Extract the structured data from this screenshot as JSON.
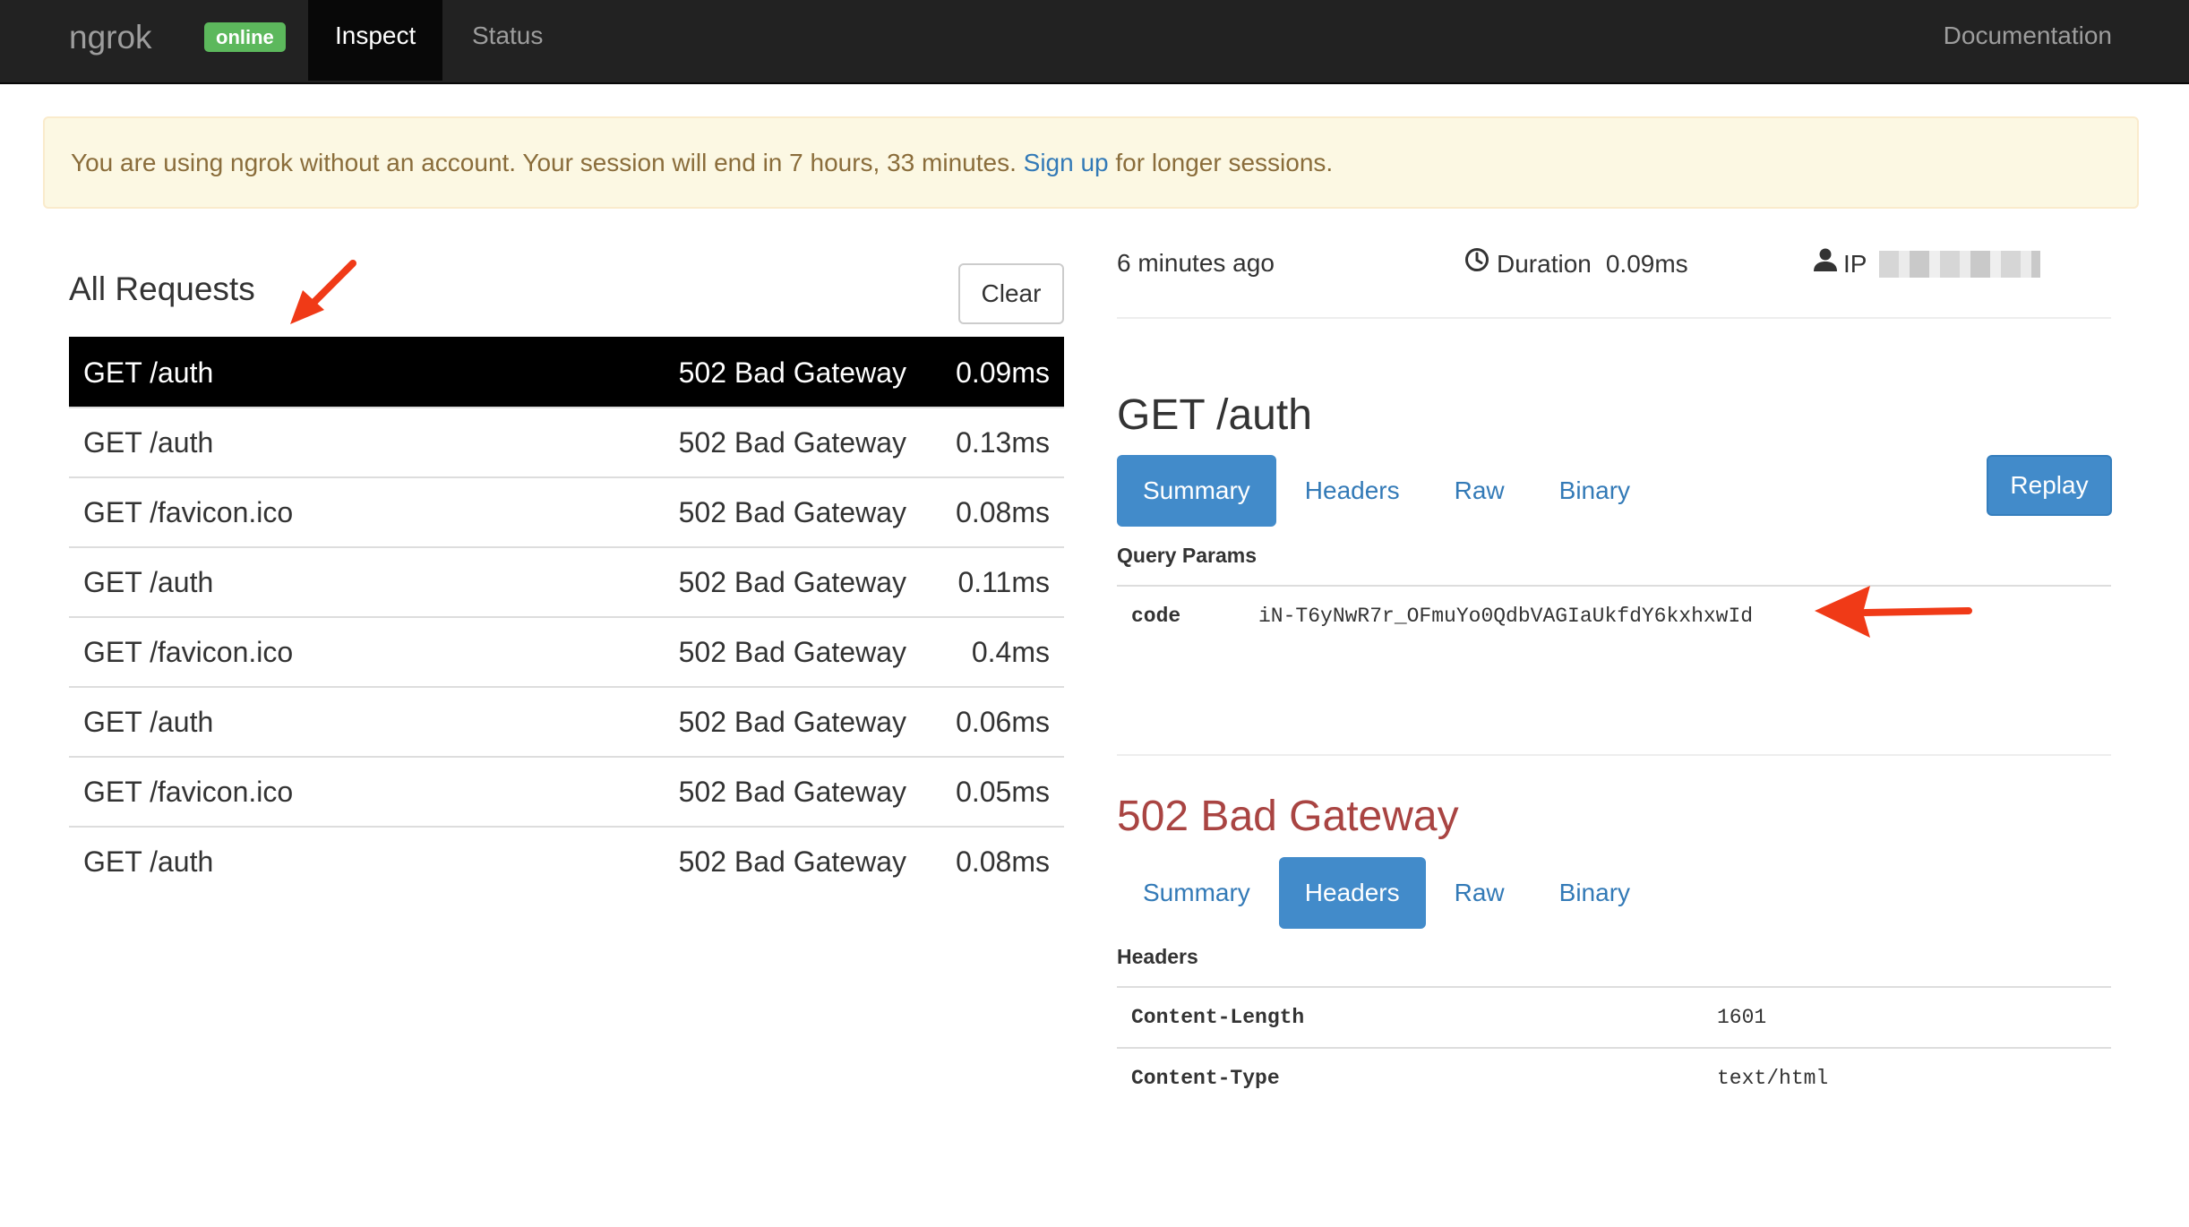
{
  "navbar": {
    "brand": "ngrok",
    "status_badge": "online",
    "tabs": [
      {
        "label": "Inspect",
        "active": true
      },
      {
        "label": "Status",
        "active": false
      }
    ],
    "docs_link": "Documentation"
  },
  "alert": {
    "text_before": "You are using ngrok without an account. Your session will end in 7 hours, 33 minutes. ",
    "link": "Sign up",
    "text_after": " for longer sessions."
  },
  "requests": {
    "title": "All Requests",
    "clear_label": "Clear",
    "rows": [
      {
        "path": "GET /auth",
        "status": "502 Bad Gateway",
        "duration": "0.09ms",
        "selected": true
      },
      {
        "path": "GET /auth",
        "status": "502 Bad Gateway",
        "duration": "0.13ms"
      },
      {
        "path": "GET /favicon.ico",
        "status": "502 Bad Gateway",
        "duration": "0.08ms"
      },
      {
        "path": "GET /auth",
        "status": "502 Bad Gateway",
        "duration": "0.11ms"
      },
      {
        "path": "GET /favicon.ico",
        "status": "502 Bad Gateway",
        "duration": "0.4ms"
      },
      {
        "path": "GET /auth",
        "status": "502 Bad Gateway",
        "duration": "0.06ms"
      },
      {
        "path": "GET /favicon.ico",
        "status": "502 Bad Gateway",
        "duration": "0.05ms"
      },
      {
        "path": "GET /auth",
        "status": "502 Bad Gateway",
        "duration": "0.08ms"
      }
    ]
  },
  "detail": {
    "time_ago": "6 minutes ago",
    "duration_label": "Duration",
    "duration_value": "0.09ms",
    "ip_label": "IP",
    "request": {
      "heading": "GET /auth",
      "tabs": [
        "Summary",
        "Headers",
        "Raw",
        "Binary"
      ],
      "active_tab": "Summary",
      "replay_label": "Replay",
      "params_label": "Query Params",
      "params": [
        {
          "key": "code",
          "value": "iN-T6yNwR7r_OFmuYo0QdbVAGIaUkfdY6kxhxwId"
        }
      ]
    },
    "response": {
      "heading": "502 Bad Gateway",
      "tabs": [
        "Summary",
        "Headers",
        "Raw",
        "Binary"
      ],
      "active_tab": "Headers",
      "headers_label": "Headers",
      "headers": [
        {
          "key": "Content-Length",
          "value": "1601"
        },
        {
          "key": "Content-Type",
          "value": "text/html"
        }
      ]
    }
  },
  "colors": {
    "navbar_bg": "#222222",
    "online_green": "#5cb85c",
    "link_blue": "#337ab7",
    "active_pill": "#428bca",
    "error_red": "#a94442",
    "alert_bg": "#fcf8e3",
    "annotation_arrow": "#f03a17"
  }
}
